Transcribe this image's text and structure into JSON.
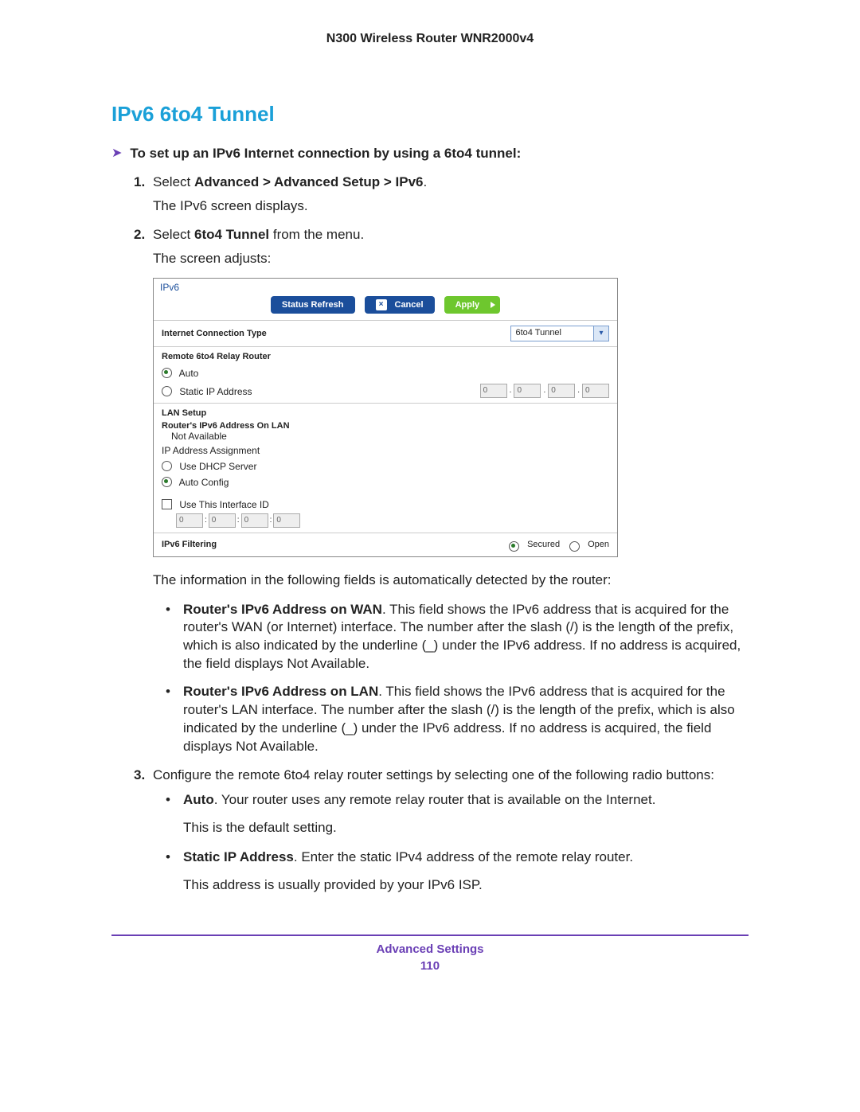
{
  "header": "N300 Wireless Router WNR2000v4",
  "title": "IPv6 6to4 Tunnel",
  "intro": "To set up an IPv6 Internet connection by using a 6to4 tunnel:",
  "step1": {
    "num": "1.",
    "text_before": "Select ",
    "bold": "Advanced > Advanced Setup > IPv6",
    "text_after": ".",
    "sub": "The IPv6 screen displays."
  },
  "step2": {
    "num": "2.",
    "text_before": "Select ",
    "bold": "6to4 Tunnel",
    "text_after": " from the menu.",
    "sub": "The screen adjusts:"
  },
  "panel": {
    "title": "IPv6",
    "btn_refresh": "Status Refresh",
    "btn_cancel": "Cancel",
    "btn_apply": "Apply",
    "conn_type_label": "Internet Connection Type",
    "conn_type_value": "6to4 Tunnel",
    "relay": {
      "header": "Remote 6to4 Relay Router",
      "auto": "Auto",
      "static": "Static IP Address",
      "oct1": "0",
      "oct2": "0",
      "oct3": "0",
      "oct4": "0"
    },
    "lan": {
      "header": "LAN Setup",
      "row1": "Router's IPv6 Address On LAN",
      "row1_val": "Not Available",
      "assign": "IP Address Assignment",
      "dhcp": "Use DHCP Server",
      "autoconf": "Auto Config",
      "useid": "Use This Interface ID",
      "b1": "0",
      "b2": "0",
      "b3": "0",
      "b4": "0"
    },
    "filter": {
      "label": "IPv6 Filtering",
      "secured": "Secured",
      "open": "Open"
    }
  },
  "after_panel": "The information in the following fields is automatically detected by the router:",
  "bullets1": {
    "a_bold": "Router's IPv6 Address on WAN",
    "a_text": ". This field shows the IPv6 address that is acquired for the router's WAN (or Internet) interface. The number after the slash (/) is the length of the prefix, which is also indicated by the underline (_) under the IPv6 address. If no address is acquired, the field displays Not Available.",
    "b_bold": "Router's IPv6 Address on LAN",
    "b_text": ". This field shows the IPv6 address that is acquired for the router's LAN interface. The number after the slash (/) is the length of the prefix, which is also indicated by the underline (_) under the IPv6 address. If no address is acquired, the field displays Not Available."
  },
  "step3": {
    "num": "3.",
    "text": "Configure the remote 6to4 relay router settings by selecting one of the following radio buttons:"
  },
  "bullets2": {
    "a_bold": "Auto",
    "a_text": ". Your router uses any remote relay router that is available on the Internet.",
    "a_sub": "This is the default setting.",
    "b_bold": "Static IP Address",
    "b_text": ". Enter the static IPv4 address of the remote relay router.",
    "b_sub": "This address is usually provided by your IPv6 ISP."
  },
  "footer": {
    "section": "Advanced Settings",
    "page": "110"
  }
}
